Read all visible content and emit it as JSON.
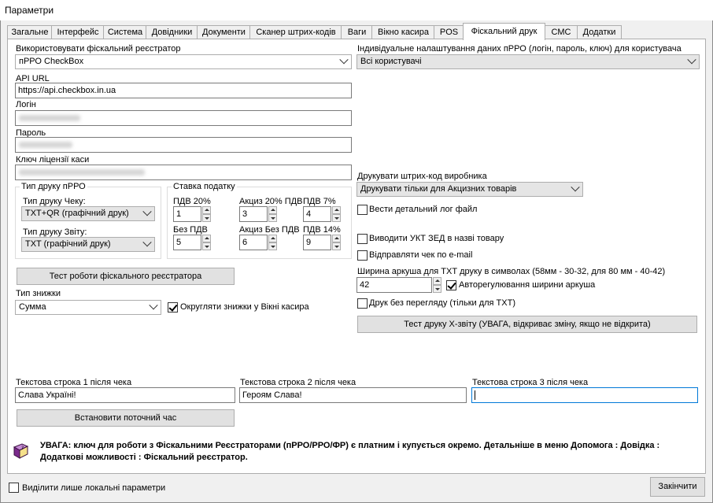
{
  "window": {
    "title": "Параметри"
  },
  "tabs": [
    "Загальне",
    "Інтерфейс",
    "Система",
    "Довідники",
    "Документи",
    "Сканер штрих-кодів",
    "Ваги",
    "Вікно касира",
    "POS",
    "Фіскальний друк",
    "СМС",
    "Додатки"
  ],
  "active_tab": "Фіскальний друк",
  "fiscal": {
    "use_label": "Використовувати фіскальний реєстратор",
    "use_value": "пРРО CheckBox",
    "api_url_label": "API URL",
    "api_url_value": "https://api.checkbox.in.ua",
    "login_label": "Логін",
    "password_label": "Пароль",
    "license_label": "Ключ ліцензії каси"
  },
  "print_type": {
    "group_title": "Тип друку пРРО",
    "receipt_label": "Тип друку Чеку:",
    "receipt_value": "TXT+QR (графічний друк)",
    "report_label": "Тип друку Звіту:",
    "report_value": "TXT (графічний друк)"
  },
  "tax_rate": {
    "group_title": "Ставка податку",
    "items": [
      {
        "label": "ПДВ 20%",
        "value": "1"
      },
      {
        "label": "Акциз 20% ПДВ",
        "value": "3"
      },
      {
        "label": "ПДВ 7%",
        "value": "4"
      },
      {
        "label": "Без ПДВ",
        "value": "5"
      },
      {
        "label": "Акциз Без ПДВ",
        "value": "6"
      },
      {
        "label": "ПДВ 14%",
        "value": "9"
      }
    ]
  },
  "test_fiscal_button": "Тест роботи фіскального реєстратора",
  "discount": {
    "label": "Тип знижки",
    "value": "Сумма",
    "round_label": "Округляти знижки у Вікні касира",
    "round_checked": true
  },
  "right": {
    "individual_label": "Індивідуальне налаштування даних пРРО (логін, пароль, ключ) для користувача",
    "individual_value": "Всі користувачі",
    "barcode_label": "Друкувати штрих-код виробника",
    "barcode_value": "Друкувати тільки для Акцизних товарів",
    "detailed_log_label": "Вести детальний лог файл",
    "uktzed_label": "Виводити УКТ ЗЕД в назві товару",
    "email_label": "Відправляти чек по e-mail",
    "width_label": "Ширина аркуша для ТХТ друку в символах (58мм - 30-32, для 80 мм - 40-42)",
    "width_value": "42",
    "auto_width_label": "Авторегулювання ширини аркуша",
    "no_preview_label": "Друк без перегляду (тільки для ТХТ)",
    "test_x_button": "Тест друку Х-звіту (УВАГА, відкриває зміну, якщо не відкрита)"
  },
  "text_lines": [
    {
      "label": "Текстова строка 1 після чека",
      "value": "Слава Україні!"
    },
    {
      "label": "Текстова строка 2 після чека",
      "value": "Героям Слава!"
    },
    {
      "label": "Текстова строка 3 після чека",
      "value": ""
    }
  ],
  "set_time_button": "Встановити поточний час",
  "warning": {
    "line1": "УВАГА: ключ для роботи з Фіскальними Реєстраторами (пРРО/РРО/ФР) є платним і купується окремо. Детальніше в меню Допомога : Довідка :",
    "line2": "Додаткові можливості : Фіскальний реєстратор."
  },
  "footer": {
    "local_only_label": "Виділити лише локальні параметри",
    "finish_button": "Закінчити"
  },
  "colors": {
    "accent": "#0078d7",
    "book": "#7b2a8c"
  }
}
